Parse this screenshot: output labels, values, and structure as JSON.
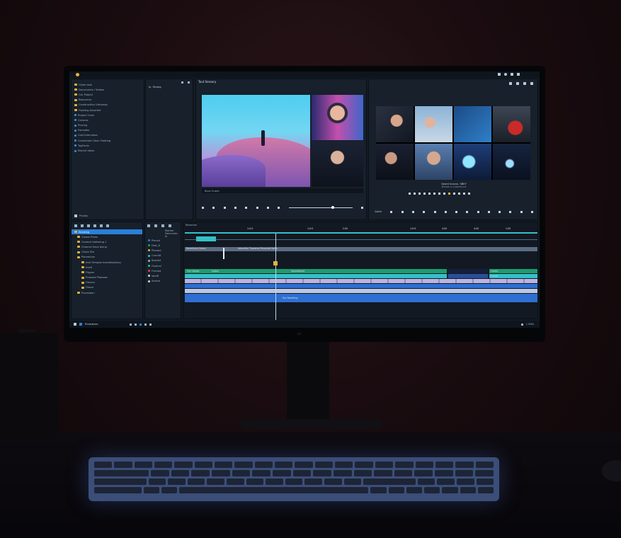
{
  "app": {
    "monitor_brand": "LG",
    "colors": {
      "accent": "#2a80d8",
      "clip_green": "#1f9b6e",
      "clip_teal": "#34c0c9",
      "clip_lavender": "#b9b4e3",
      "clip_blue": "#2f6fd1",
      "playhead": "#b8dce6"
    }
  },
  "project_panel": {
    "items": [
      {
        "label": "Clean look",
        "icon": "folder"
      },
      {
        "label": "Documents / Videos",
        "icon": "folder"
      },
      {
        "label": "Our Project",
        "icon": "folder"
      },
      {
        "label": "Resources",
        "icon": "folder"
      },
      {
        "label": "Construction Ultramap",
        "icon": "folder"
      },
      {
        "label": "Floating Assorted",
        "icon": "folder"
      },
      {
        "label": "Project Lines",
        "icon": "dot"
      },
      {
        "label": "Caracas",
        "icon": "dot"
      },
      {
        "label": "Procing",
        "icon": "dot"
      },
      {
        "label": "Fomodes",
        "icon": "dot"
      },
      {
        "label": "Cost Interviews",
        "icon": "dot"
      },
      {
        "label": "Connected Clean Floating",
        "icon": "dot"
      },
      {
        "label": "TopFonts",
        "icon": "dot"
      },
      {
        "label": "Recent Ideas",
        "icon": "dot"
      }
    ],
    "footer_label": "Prostly"
  },
  "effects_panel": {
    "tab": "In. Strang"
  },
  "bins_panel": {
    "root": "Secsting",
    "items": [
      "Create Prese",
      "Content Settering 1",
      "Channel Save being",
      "Clasin Ste",
      "Placesinse",
      "Insit Templat Installesedony",
      "Instit",
      "Flipper",
      "Prasand Phatows",
      "Flavers",
      "Flesce",
      "Procestion"
    ]
  },
  "source_monitor": {
    "title": "Tout Sessory",
    "timecode_label": "Bout Onwin"
  },
  "program_monitor": {
    "caption": "Gearil Inconn. SBEY",
    "subcaption": "Beads a mutemunt",
    "quick_label": "Quick"
  },
  "timeline": {
    "sequence_label": "Bearmon",
    "ruler_marks": [
      "1:0:0",
      "1:0:0",
      "2:00",
      "1:0:9",
      "4:00",
      "4:00",
      "1:00"
    ],
    "marker_label": "Marker",
    "marker_label2": "Dercenter le",
    "track_names": [
      "Pleced",
      "Feet_8",
      "Pleated",
      "Crandit",
      "Bawled",
      "Osmirel",
      "Fluitied",
      "Vool8",
      "Sortod"
    ],
    "clip_labels": {
      "v1_a": "Cnn Vossip",
      "v1_b": "Insiter",
      "v1_c": "Vacarsfored",
      "v1_d": "Coroid",
      "v1_e": "Cvcod",
      "a1": "Sys Racetling",
      "header_clip": "Beverlinne Swam",
      "header_clip2": "Adscetter Trowered Peneratlt Ballin"
    }
  },
  "taskbar": {
    "app_label": "Promatron",
    "tray_time": "1 EMA"
  }
}
